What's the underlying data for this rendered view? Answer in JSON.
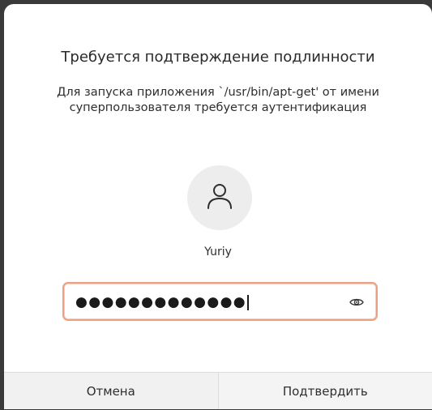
{
  "dialog": {
    "title": "Требуется подтверждение подлинности",
    "message": "Для запуска приложения `/usr/bin/apt-get' от имени суперпользователя требуется аутентификация",
    "user": {
      "avatar_icon": "user-icon",
      "name": "Yuriy"
    },
    "password": {
      "masked_value": "●●●●●●●●●●●●●",
      "peek_icon": "eye-icon"
    },
    "buttons": {
      "cancel": "Отмена",
      "confirm": "Подтвердить"
    }
  },
  "colors": {
    "focus_border": "#e9a083",
    "background": "#ffffff",
    "footer": "#f1f1f1"
  }
}
